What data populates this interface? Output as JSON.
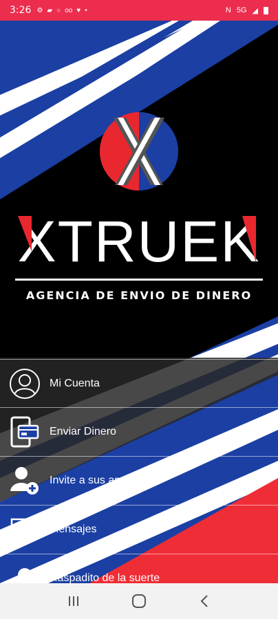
{
  "status_bar": {
    "time": "3:26",
    "left_icons": [
      "gear-icon",
      "chat-icon",
      "circle-icon",
      "voicemail-icon",
      "pet-icon",
      "dot-icon"
    ],
    "network": "5G"
  },
  "brand": {
    "name": "XTRUEK",
    "tagline": "AGENCIA DE ENVIO DE DINERO",
    "colors": {
      "red": "#e8282e",
      "blue": "#1b3fa3",
      "black": "#000000",
      "white": "#ffffff"
    }
  },
  "menu": {
    "items": [
      {
        "label": "Mi Cuenta",
        "icon": "user-circle-icon"
      },
      {
        "label": "Enviar Dinero",
        "icon": "mobile-card-icon"
      },
      {
        "label": "Invite a sus amigos",
        "icon": "add-user-icon"
      },
      {
        "label": "Mensajes",
        "icon": "message-icon"
      },
      {
        "label": "Raspadito de la suerte",
        "icon": "lucky-icon"
      }
    ]
  },
  "nav_bar": {
    "buttons": [
      "recent-apps-icon",
      "home-icon",
      "back-icon"
    ]
  }
}
